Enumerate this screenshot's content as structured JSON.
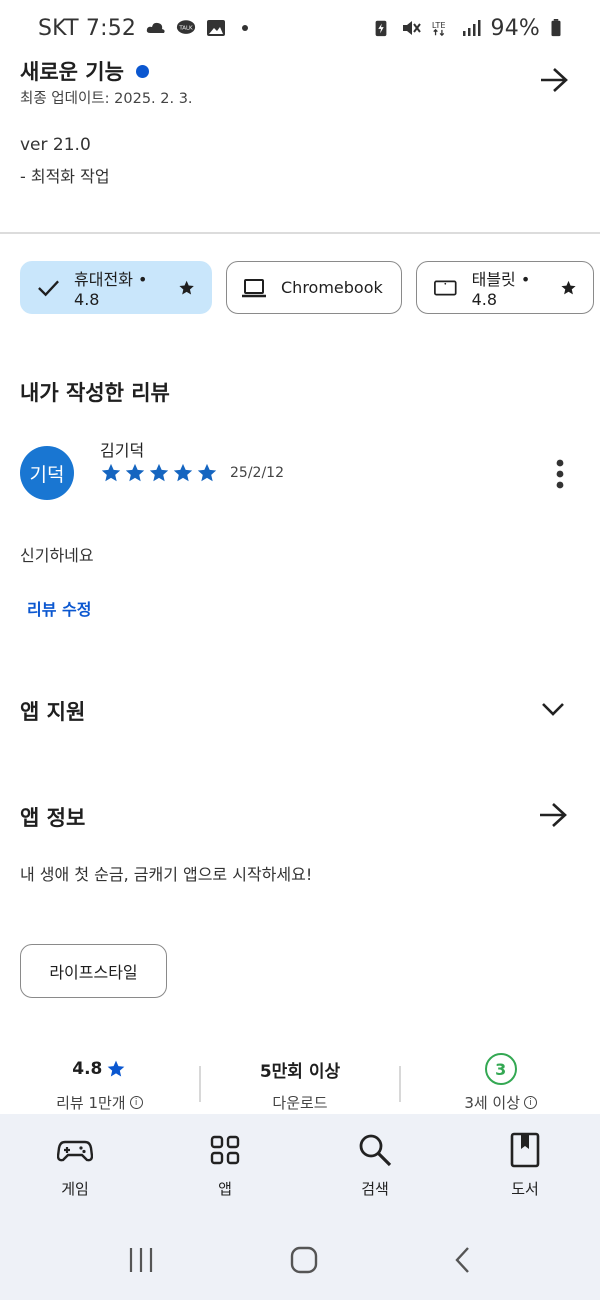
{
  "status_bar": {
    "carrier_time": "SKT 7:52",
    "battery": "94%"
  },
  "whats_new": {
    "title": "새로운 기능",
    "updated": "최종 업데이트: 2025. 2. 3.",
    "version": "ver 21.0",
    "notes": "- 최적화 작업"
  },
  "device_chips": [
    {
      "label": "휴대전화 • 4.8",
      "selected": true
    },
    {
      "label": "Chromebook",
      "selected": false
    },
    {
      "label": "태블릿 • 4.8",
      "selected": false
    }
  ],
  "my_review": {
    "heading": "내가 작성한 리뷰",
    "avatar_text": "기덕",
    "author": "김기덕",
    "rating": 5,
    "date": "25/2/12",
    "body": "신기하네요",
    "edit_label": "리뷰 수정"
  },
  "app_support": {
    "title": "앱 지원"
  },
  "app_info": {
    "title": "앱 정보",
    "description": "내 생애 첫 순금, 금캐기 앱으로 시작하세요!",
    "category_tag": "라이프스타일"
  },
  "stats": {
    "rating_value": "4.8",
    "rating_label": "리뷰 1만개",
    "downloads_value": "5만회 이상",
    "downloads_label": "다운로드",
    "age_value": "3",
    "age_label": "3세 이상"
  },
  "bottom_nav": [
    {
      "label": "게임",
      "icon": "gamepad-icon"
    },
    {
      "label": "앱",
      "icon": "apps-grid-icon"
    },
    {
      "label": "검색",
      "icon": "search-icon"
    },
    {
      "label": "도서",
      "icon": "book-icon"
    }
  ],
  "colors": {
    "accent_blue": "#0b57d0",
    "chip_selected_bg": "#c9e6fb",
    "star_blue": "#1565c0",
    "age_green": "#34a853",
    "nav_bg": "#eef1f7"
  }
}
